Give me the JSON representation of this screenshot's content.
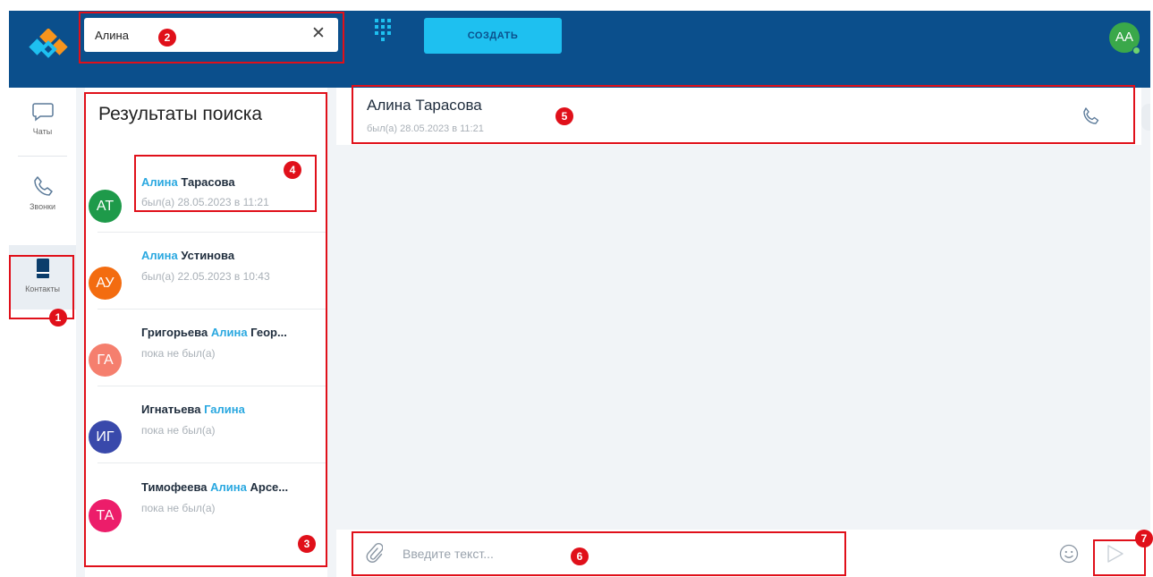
{
  "header": {
    "search_value": "Алина",
    "create_label": "СОЗДАТЬ",
    "user_initials": "АА"
  },
  "nav": {
    "items": [
      {
        "label": "Чаты"
      },
      {
        "label": "Звонки"
      },
      {
        "label": "Контакты"
      }
    ]
  },
  "results": {
    "title": "Результаты поиска",
    "items": [
      {
        "initials": "АТ",
        "color": "#1e9a4a",
        "name_pre": "",
        "name_hl": "Алина",
        "name_post": " Тарасова",
        "sub": "был(а) 28.05.2023 в 11:21"
      },
      {
        "initials": "АУ",
        "color": "#f36c10",
        "name_pre": "",
        "name_hl": "Алина",
        "name_post": " Устинова",
        "sub": "был(а) 22.05.2023 в 10:43"
      },
      {
        "initials": "ГА",
        "color": "#f57f6e",
        "name_pre": "Григорьева ",
        "name_hl": "Алина",
        "name_post": " Геор...",
        "sub": "пока не был(а)"
      },
      {
        "initials": "ИГ",
        "color": "#3949ab",
        "name_pre": "Игнатьева ",
        "name_hl": "Галина",
        "name_post": "",
        "sub": "пока не был(а)"
      },
      {
        "initials": "ТА",
        "color": "#ec1d6a",
        "name_pre": "Тимофеева ",
        "name_hl": "Алина",
        "name_post": " Арсе...",
        "sub": "пока не был(а)"
      }
    ]
  },
  "chat": {
    "contact_name": "Алина Тарасова",
    "contact_status": "был(а) 28.05.2023 в 11:21",
    "input_placeholder": "Введите текст..."
  },
  "annotations": {
    "labels": [
      "1",
      "2",
      "3",
      "4",
      "5",
      "6",
      "7"
    ],
    "color": "#e0101a"
  },
  "colors": {
    "topbar": "#0b4f8c",
    "accent": "#1ec0f0",
    "highlight": "#2aa8e0"
  }
}
